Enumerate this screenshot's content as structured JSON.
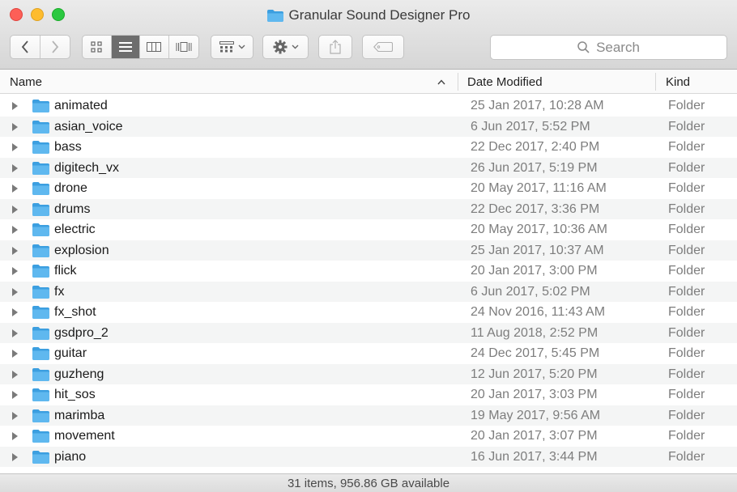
{
  "window": {
    "title": "Granular Sound Designer Pro"
  },
  "toolbar": {
    "back": "back-arrow",
    "forward": "forward-arrow",
    "view_modes": [
      "icon-view",
      "list-view",
      "column-view",
      "cover-flow-view"
    ],
    "active_view": "list-view",
    "group": "group-by-icon",
    "action": "gear-icon",
    "share": "share-icon",
    "tag": "tag-icon",
    "search_placeholder": "Search"
  },
  "columns": {
    "name": "Name",
    "date": "Date Modified",
    "kind": "Kind",
    "sort_indicator": "^"
  },
  "items": [
    {
      "name": "animated",
      "date": "25 Jan 2017, 10:28 AM",
      "kind": "Folder"
    },
    {
      "name": "asian_voice",
      "date": "6 Jun 2017, 5:52 PM",
      "kind": "Folder"
    },
    {
      "name": "bass",
      "date": "22 Dec 2017, 2:40 PM",
      "kind": "Folder"
    },
    {
      "name": "digitech_vx",
      "date": "26 Jun 2017, 5:19 PM",
      "kind": "Folder"
    },
    {
      "name": "drone",
      "date": "20 May 2017, 11:16 AM",
      "kind": "Folder"
    },
    {
      "name": "drums",
      "date": "22 Dec 2017, 3:36 PM",
      "kind": "Folder"
    },
    {
      "name": "electric",
      "date": "20 May 2017, 10:36 AM",
      "kind": "Folder"
    },
    {
      "name": "explosion",
      "date": "25 Jan 2017, 10:37 AM",
      "kind": "Folder"
    },
    {
      "name": "flick",
      "date": "20 Jan 2017, 3:00 PM",
      "kind": "Folder"
    },
    {
      "name": "fx",
      "date": "6 Jun 2017, 5:02 PM",
      "kind": "Folder"
    },
    {
      "name": "fx_shot",
      "date": "24 Nov 2016, 11:43 AM",
      "kind": "Folder"
    },
    {
      "name": "gsdpro_2",
      "date": "11 Aug 2018, 2:52 PM",
      "kind": "Folder"
    },
    {
      "name": "guitar",
      "date": "24 Dec 2017, 5:45 PM",
      "kind": "Folder"
    },
    {
      "name": "guzheng",
      "date": "12 Jun 2017, 5:20 PM",
      "kind": "Folder"
    },
    {
      "name": "hit_sos",
      "date": "20 Jan 2017, 3:03 PM",
      "kind": "Folder"
    },
    {
      "name": "marimba",
      "date": "19 May 2017, 9:56 AM",
      "kind": "Folder"
    },
    {
      "name": "movement",
      "date": "20 Jan 2017, 3:07 PM",
      "kind": "Folder"
    },
    {
      "name": "piano",
      "date": "16 Jun 2017, 3:44 PM",
      "kind": "Folder"
    }
  ],
  "status": {
    "text": "31 items, 956.86 GB available"
  },
  "colors": {
    "folder": "#5fb8ef",
    "folder_tab": "#3c9fe0"
  }
}
